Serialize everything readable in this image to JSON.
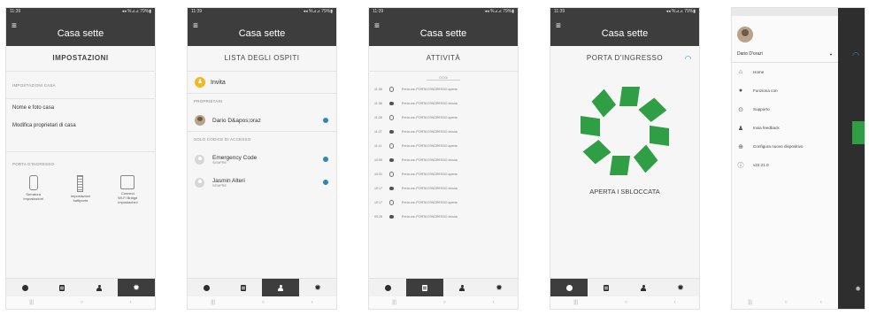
{
  "status_bar": {
    "time": "11:39",
    "right": "◂◂ %⊿⊿ 79%▮"
  },
  "app_title": "Casa sette",
  "screens": [
    {
      "header": "IMPOSTAZIONI",
      "section_home": "IMPOSTAZIONI CASA",
      "items": [
        "Nome e foto casa",
        "Modifica proprietari di casa"
      ],
      "section_door": "PORTA D'INGRESSO",
      "door_options": [
        {
          "label": "Serratura\nImpostazioni"
        },
        {
          "label": "Impostazioni\nbattiporta"
        },
        {
          "label": "Connect\nWi-Fi Bridge\nImpostazioni"
        }
      ],
      "active_tab": 3
    },
    {
      "header": "LISTA DEGLI OSPITI",
      "invite": "Invita",
      "section_owners": "PROPRIETARI",
      "owner": "Dario D&apos;oraz",
      "section_codes": "SOLO CODICE DI ACCESSO",
      "guests": [
        {
          "name": "Emergency Code",
          "sub": "SEMPRE"
        },
        {
          "name": "Jasmin Alteri",
          "sub": "SEMPRE"
        }
      ],
      "active_tab": 2
    },
    {
      "header": "ATTIVITÀ",
      "date_label": "OGGI",
      "log": [
        {
          "time": "11:38",
          "text": "Porta con PORTA D'INGRESSO aperta",
          "type": "open"
        },
        {
          "time": "11:36",
          "text": "Porta con PORTA D'INGRESSO chiusa",
          "type": "closed"
        },
        {
          "time": "11:28",
          "text": "Porta con PORTA D'INGRESSO aperta",
          "type": "open"
        },
        {
          "time": "11:27",
          "text": "Porta con PORTA D'INGRESSO chiusa",
          "type": "closed"
        },
        {
          "time": "11:11",
          "text": "Porta con PORTA D'INGRESSO aperta",
          "type": "open"
        },
        {
          "time": "10:59",
          "text": "Porta con PORTA D'INGRESSO chiusa",
          "type": "closed"
        },
        {
          "time": "10:31",
          "text": "Porta con PORTA D'INGRESSO aperta",
          "type": "open"
        },
        {
          "time": "10:17",
          "text": "Porta con PORTA D'INGRESSO chiusa",
          "type": "closed"
        },
        {
          "time": "10:17",
          "text": "Porta con PORTA D'INGRESSO aperta",
          "type": "open"
        },
        {
          "time": "09:26",
          "text": "Porta con PORTA D'INGRESSO chiusa",
          "type": "closed"
        }
      ],
      "active_tab": 1
    },
    {
      "header": "PORTA D'INGRESSO",
      "status": "APERTA I SBLOCCATA",
      "active_tab": 0
    },
    {
      "user": "Dario D'orazi",
      "menu": [
        {
          "icon": "home-icon",
          "label": "Home"
        },
        {
          "icon": "works-with-icon",
          "label": "Funziona con"
        },
        {
          "icon": "support-icon",
          "label": "Supporto"
        },
        {
          "icon": "feedback-icon",
          "label": "Invia feedback"
        },
        {
          "icon": "add-device-icon",
          "label": "Configura nuovo dispositivo"
        },
        {
          "icon": "info-icon",
          "label": "v22.21.0"
        }
      ]
    }
  ],
  "colors": {
    "appbar": "#3d3d3d",
    "accent_green": "#2f9e44",
    "badge_blue": "#2f86b8",
    "wifi_teal": "#1aa0b8"
  }
}
